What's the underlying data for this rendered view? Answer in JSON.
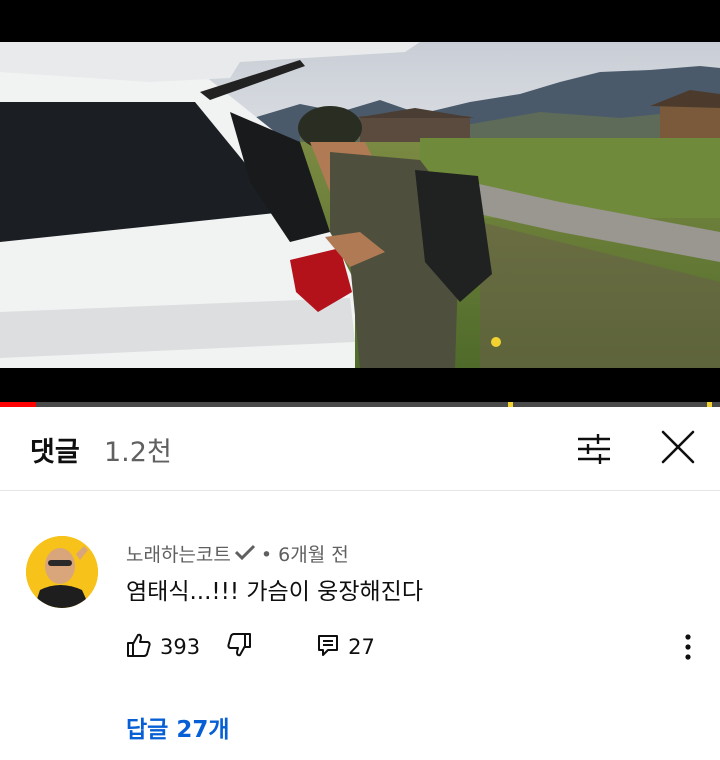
{
  "video": {
    "progress_fraction": 0.05,
    "chapter_markers": [
      0.705,
      0.982
    ]
  },
  "comments_header": {
    "title": "댓글",
    "count": "1.2천",
    "sort_icon": "sort-sliders-icon",
    "close_icon": "close-icon"
  },
  "comment": {
    "author": "노래하는코트",
    "verified_icon": "verified-check-icon",
    "time": "• 6개월 전",
    "text": "염태식...!!! 가슴이 웅장해진다",
    "likes": "393",
    "replies_count": "27",
    "like_icon": "thumbs-up-icon",
    "dislike_icon": "thumbs-down-icon",
    "reply_icon": "reply-icon",
    "more_icon": "more-vert-icon",
    "replies_link": "답글 27개"
  },
  "colors": {
    "link": "#065fd4",
    "secondary_text": "#606060",
    "progress": "#ff0000",
    "avatar_bg": "#f7c21a"
  }
}
